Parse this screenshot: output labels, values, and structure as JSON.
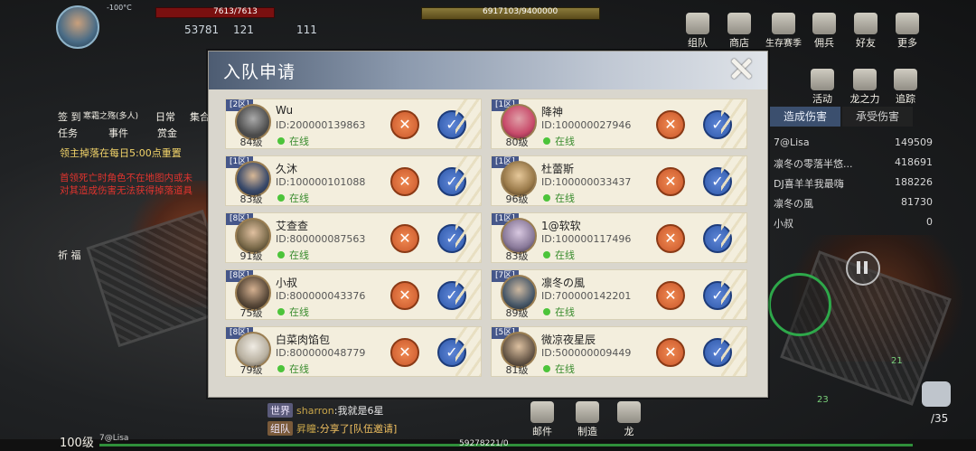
{
  "hud": {
    "temperature": "-100°C",
    "hp_text": "7613/7613",
    "resources": [
      "53781",
      "121",
      "111"
    ],
    "boss_hp": "6917103/9400000",
    "top_buttons": [
      {
        "label": "组队",
        "icon": "team-icon"
      },
      {
        "label": "商店",
        "icon": "shop-icon"
      },
      {
        "label": "生存赛季",
        "icon": "season-icon"
      },
      {
        "label": "佣兵",
        "icon": "mercenary-icon"
      },
      {
        "label": "好友",
        "icon": "friends-icon"
      },
      {
        "label": "更多",
        "icon": "more-icon"
      }
    ],
    "right_buttons": [
      {
        "label": "活动",
        "icon": "event-icon"
      },
      {
        "label": "龙之力",
        "icon": "dragon-icon"
      },
      {
        "label": "追踪",
        "icon": "track-icon"
      }
    ],
    "left_menu": {
      "sign_in": "签 到",
      "cold_event": "寒霜之殇(多人)",
      "daily": "日常",
      "collect": "集合",
      "task": "任务",
      "event": "事件",
      "bounty": "赏金",
      "gift": "祈 福"
    },
    "yellow_notice": "领主掉落在每日5:00点重置",
    "red_notice_1": "首领死亡时角色不在地图内或未",
    "red_notice_2": "对其造成伤害无法获得掉落道具",
    "damage_tabs": [
      "造成伤害",
      "承受伤害"
    ],
    "damage_rank": [
      {
        "name": "7@Lisa",
        "value": "149509"
      },
      {
        "name": "凛冬の零落半悠...",
        "value": "418691"
      },
      {
        "name": "DJ喜羊羊我最嗨",
        "value": "188226"
      },
      {
        "name": "凛冬の風",
        "value": "81730"
      },
      {
        "name": "小叔",
        "value": "0"
      }
    ],
    "chat": [
      {
        "channel": "世界",
        "sender": "sharron",
        "text": ":我就是6星"
      },
      {
        "channel": "组队",
        "sender": "昇瞳",
        "text": ":分享了[队伍邀请]"
      }
    ],
    "bottom_buttons": [
      {
        "label": "邮件",
        "icon": "mail-icon"
      },
      {
        "label": "制造",
        "icon": "craft-icon"
      },
      {
        "label": "龙",
        "icon": "dragon-small-icon"
      }
    ],
    "player_level": "100级",
    "player_name": "7@Lisa",
    "xp_text": "59278221/0",
    "bag_count": "/35",
    "badge_21": "21",
    "badge_23": "23"
  },
  "modal": {
    "title": "入队申请",
    "applicants": [
      {
        "zone": "[2区]",
        "name": "Wu",
        "id": "ID:200000139863",
        "status": "在线",
        "level": "84级",
        "color": "#4a4a4a"
      },
      {
        "zone": "[1区]",
        "name": "降神",
        "id": "ID:100000027946",
        "status": "在线",
        "level": "80级",
        "color": "#c84a6a"
      },
      {
        "zone": "[1区]",
        "name": "久沐",
        "id": "ID:100000101088",
        "status": "在线",
        "level": "83级",
        "color": "#3a4a6a"
      },
      {
        "zone": "[1区]",
        "name": "杜蕾斯",
        "id": "ID:100000033437",
        "status": "在线",
        "level": "96级",
        "color": "#9a7a4a"
      },
      {
        "zone": "[8区]",
        "name": "艾查查",
        "id": "ID:800000087563",
        "status": "在线",
        "level": "91级",
        "color": "#7a6a4a"
      },
      {
        "zone": "[1区]",
        "name": "1@软软",
        "id": "ID:100000117496",
        "status": "在线",
        "level": "83级",
        "color": "#8a7a9a"
      },
      {
        "zone": "[8区]",
        "name": "小叔",
        "id": "ID:800000043376",
        "status": "在线",
        "level": "75级",
        "color": "#5a4a3a"
      },
      {
        "zone": "[7区]",
        "name": "凛冬の風",
        "id": "ID:700000142201",
        "status": "在线",
        "level": "89级",
        "color": "#4a5a6a"
      },
      {
        "zone": "[8区]",
        "name": "白菜肉馅包",
        "id": "ID:800000048779",
        "status": "在线",
        "level": "79级",
        "color": "#b8b0a0"
      },
      {
        "zone": "[5区]",
        "name": "微凉夜星辰",
        "id": "ID:500000009449",
        "status": "在线",
        "level": "81级",
        "color": "#6a5a4a"
      }
    ],
    "reject_glyph": "✕",
    "accept_glyph": "✓"
  }
}
